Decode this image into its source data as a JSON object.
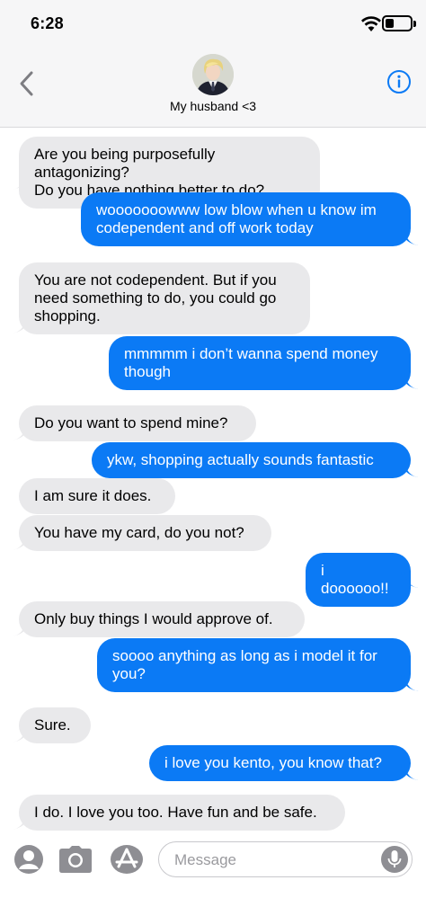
{
  "status_bar": {
    "time": "6:28",
    "battery_level": 0.35
  },
  "header": {
    "back_icon": "chevron-left-icon",
    "contact_name": "My husband <3",
    "info_icon": "info-circle-icon",
    "accent_color": "#0b7af5"
  },
  "messages": [
    {
      "direction": "incoming",
      "text": "Are you being purposefully antagonizing?\nDo you have nothing better to do?"
    },
    {
      "direction": "outgoing",
      "text": "wooooooowww low blow when u know im\ncodependent and off work today"
    },
    {
      "direction": "incoming",
      "text": "You are not codependent. But if you\nneed something to do, you could go\nshopping."
    },
    {
      "direction": "outgoing",
      "text": "mmmmm i don’t wanna spend money\nthough"
    },
    {
      "direction": "incoming",
      "text": "Do you want to spend mine?"
    },
    {
      "direction": "outgoing",
      "text": "ykw, shopping actually sounds fantastic"
    },
    {
      "direction": "incoming",
      "text": "I am sure it does."
    },
    {
      "direction": "incoming",
      "text": "You have my card, do you not?"
    },
    {
      "direction": "outgoing",
      "text": "i doooooo!!"
    },
    {
      "direction": "incoming",
      "text": "Only buy things I would approve of."
    },
    {
      "direction": "outgoing",
      "text": "soooo anything as long as i model it for\nyou?"
    },
    {
      "direction": "incoming",
      "text": "Sure."
    },
    {
      "direction": "outgoing",
      "text": "i love you kento, you know that?"
    },
    {
      "direction": "incoming",
      "text": "I do. I love you too. Have fun and be safe."
    }
  ],
  "compose": {
    "placeholder": "Message",
    "icons": [
      "memoji-icon",
      "camera-icon",
      "app-store-icon",
      "microphone-icon"
    ]
  },
  "colors": {
    "outgoing_bubble": "#0b7af5",
    "incoming_bubble": "#e9e9eb"
  }
}
